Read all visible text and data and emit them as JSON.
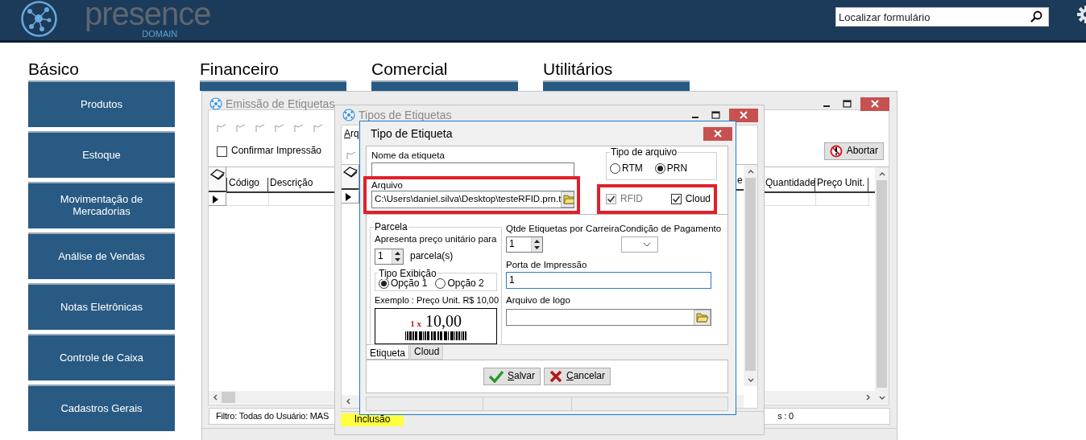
{
  "header": {
    "logo_text": "presence",
    "logo_subtext": "DOMAIN",
    "search": {
      "placeholder": "Localizar formulário"
    }
  },
  "sections": [
    {
      "title": "Básico",
      "tiles": [
        "Produtos",
        "Estoque",
        "Movimentação de Mercadorias",
        "Análise de Vendas",
        "Notas Eletrônicas",
        "Controle de Caixa",
        "Cadastros Gerais"
      ]
    },
    {
      "title": "Financeiro"
    },
    {
      "title": "Comercial"
    },
    {
      "title": "Utilitários"
    }
  ],
  "label_window": {
    "title": "Emissão de Etiquetas",
    "confirm_print": {
      "label": "Confirmar Impressão",
      "checked": false
    },
    "abort_button": "Abortar",
    "left_columns": [
      "Código",
      "Descrição"
    ],
    "right_columns": [
      "Quantidade",
      "Preço Unit."
    ],
    "filter": "Filtro: Todas do Usuário: MAS",
    "count": "s : 0"
  },
  "types_window": {
    "title": "Tipos de Etiquetas",
    "menu": [
      "Arq"
    ],
    "partial_column": "e",
    "mode": "Inclusão"
  },
  "dialog": {
    "title": "Tipo de Etiqueta",
    "name_field": {
      "label": "Nome da etiqueta"
    },
    "file_field": {
      "label": "Arquivo",
      "value": "C:\\Users\\daniel.silva\\Desktop\\testeRFID.prn.t"
    },
    "file_type": {
      "label": "Tipo de arquivo",
      "options": [
        {
          "label": "RTM",
          "selected": false
        },
        {
          "label": "PRN",
          "selected": true
        }
      ]
    },
    "flags": [
      {
        "label": "RFID",
        "checked": true,
        "disabled": true
      },
      {
        "label": "Cloud",
        "checked": true,
        "disabled": false
      }
    ],
    "installments": {
      "group": "Parcela",
      "prompt": "Apresenta preço unitário para",
      "value": "1",
      "unit": "parcela(s)",
      "display_type": {
        "label": "Tipo Exibição",
        "options": [
          {
            "label": "Opção 1",
            "selected": true
          },
          {
            "label": "Opção 2",
            "selected": false
          }
        ]
      },
      "example": "Exemplo : Preço Unit. R$ 10,00",
      "preview": {
        "count": "1 x",
        "price": "10,00"
      }
    },
    "labels_per_row": {
      "label": "Qtde Etiquetas por Carreira",
      "value": "1"
    },
    "payment_condition": {
      "label": "Condição de Pagamento"
    },
    "print_port": {
      "label": "Porta de Impressão",
      "value": "1",
      "focused": true
    },
    "logo_file": {
      "label": "Arquivo de logo"
    },
    "tabs": [
      {
        "label": "Etiqueta",
        "selected": true
      },
      {
        "label": "Cloud",
        "selected": false
      }
    ],
    "buttons": [
      {
        "label": "Salvar",
        "kind": "save"
      },
      {
        "label": "Cancelar",
        "kind": "cancel"
      }
    ]
  }
}
